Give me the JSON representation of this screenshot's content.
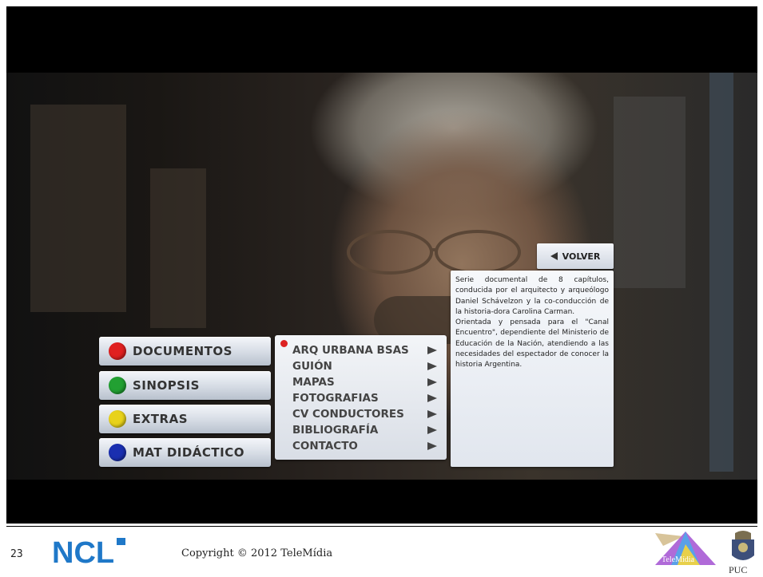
{
  "video": {
    "menu": [
      {
        "label": "DOCUMENTOS",
        "color": "#e02020"
      },
      {
        "label": "SINOPSIS",
        "color": "#22a032"
      },
      {
        "label": "EXTRAS",
        "color": "#e8d21a"
      },
      {
        "label": "MAT DIDÁCTICO",
        "color": "#1a2fb0"
      }
    ],
    "submenu": [
      "ARQ URBANA BSAS",
      "GUIÓN",
      "MAPAS",
      "FOTOGRAFIAS",
      "CV CONDUCTORES",
      "BIBLIOGRAFÍA",
      "CONTACTO"
    ],
    "volver_label": "VOLVER",
    "synopsis": [
      "Serie documental de 8 capítulos, conducida por el arquitecto y arqueólogo Daniel Schávelzon y la co-conducción de la historia-dora Carolina Carman.",
      "Orientada y pensada para el \"Canal Encuentro\", dependiente del Ministerio de Educación de la Nación, atendiendo a las necesidades del espectador de conocer la historia Argentina."
    ]
  },
  "footer": {
    "page_number": "23",
    "copyright": "Copyright © 2012 TeleMídia",
    "logos": {
      "ncl": "NCL",
      "telemidia": "TeleMídia",
      "puc": "PUC"
    }
  }
}
